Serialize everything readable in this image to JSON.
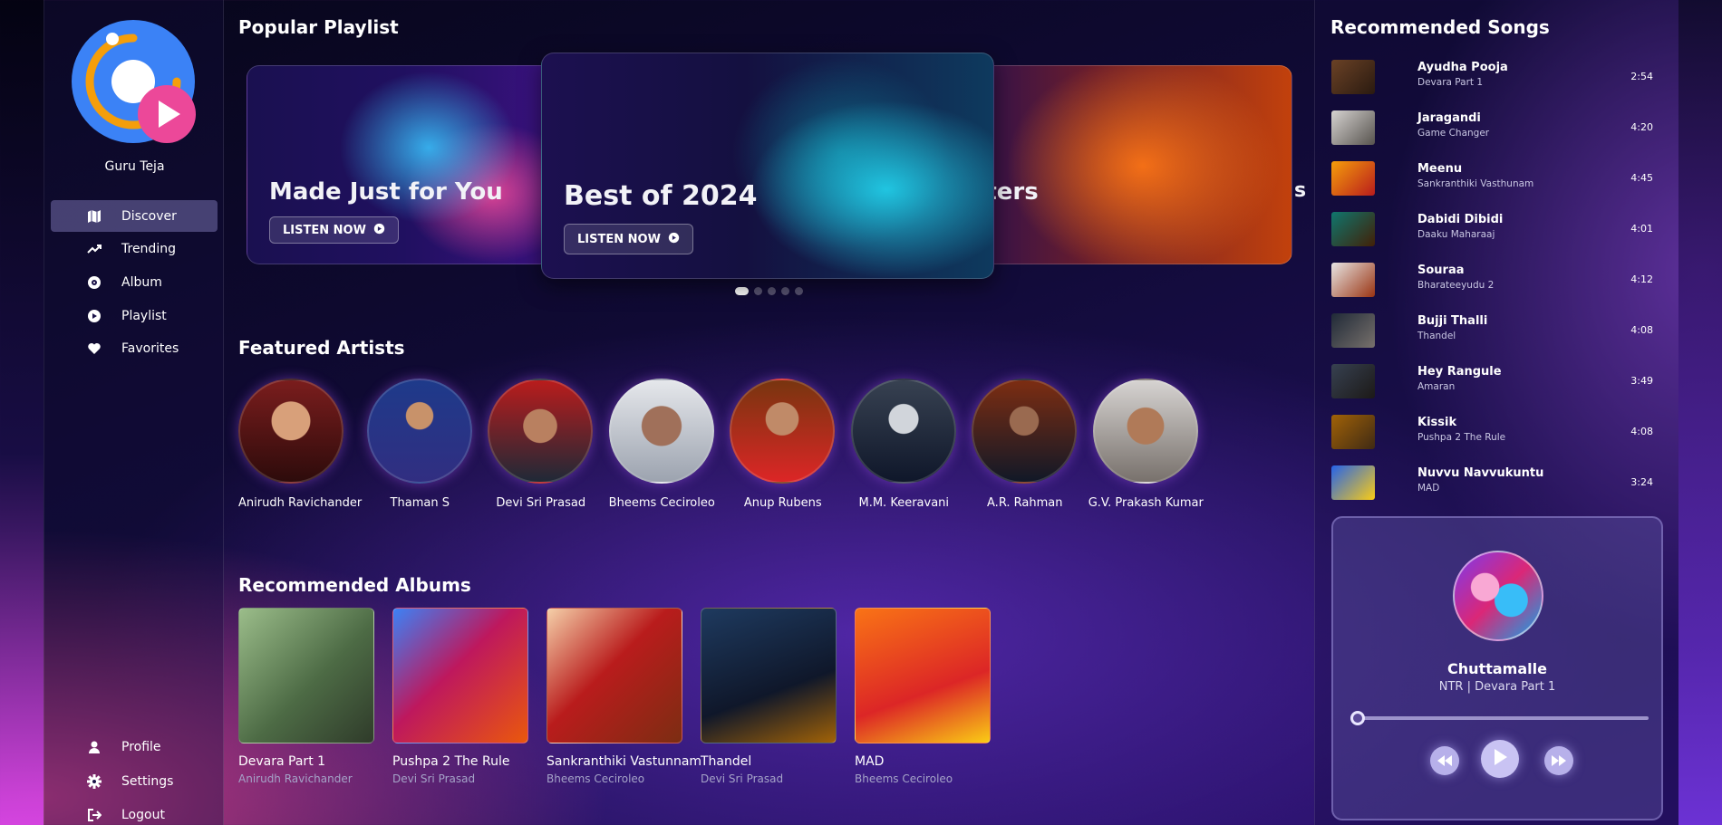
{
  "user": {
    "name": "Guru Teja"
  },
  "nav": {
    "items": [
      {
        "label": "Discover",
        "icon": "map-icon"
      },
      {
        "label": "Trending",
        "icon": "trending-icon"
      },
      {
        "label": "Album",
        "icon": "album-icon"
      },
      {
        "label": "Playlist",
        "icon": "play-circle-icon"
      },
      {
        "label": "Favorites",
        "icon": "heart-icon"
      }
    ],
    "bottom": [
      {
        "label": "Profile",
        "icon": "user-icon"
      },
      {
        "label": "Settings",
        "icon": "gear-icon"
      },
      {
        "label": "Logout",
        "icon": "logout-icon"
      }
    ]
  },
  "sections": {
    "playlist": "Popular Playlist",
    "artists": "Featured Artists",
    "albums": "Recommended Albums",
    "songs": "Recommended Songs"
  },
  "playlists": {
    "left_title": "Made Just for You",
    "center_title": "Best of 2024",
    "right_title": "arters",
    "right_edge": "s",
    "listen_label": "LISTEN NOW"
  },
  "artists": [
    "Anirudh Ravichander",
    "Thaman S",
    "Devi Sri Prasad",
    "Bheems Ceciroleo",
    "Anup Rubens",
    "M.M. Keeravani",
    "A.R. Rahman",
    "G.V. Prakash Kumar"
  ],
  "albums": [
    {
      "title": "Devara Part 1",
      "artist": "Anirudh Ravichander"
    },
    {
      "title": "Pushpa 2 The Rule",
      "artist": "Devi Sri Prasad"
    },
    {
      "title": "Sankranthiki Vastunnam",
      "artist": "Bheems Ceciroleo"
    },
    {
      "title": "Thandel",
      "artist": "Devi Sri Prasad"
    },
    {
      "title": "MAD",
      "artist": "Bheems Ceciroleo"
    }
  ],
  "songs": [
    {
      "title": "Ayudha Pooja",
      "album": "Devara Part 1",
      "duration": "2:54"
    },
    {
      "title": "Jaragandi",
      "album": "Game Changer",
      "duration": "4:20"
    },
    {
      "title": "Meenu",
      "album": "Sankranthiki Vasthunam",
      "duration": "4:45"
    },
    {
      "title": "Dabidi Dibidi",
      "album": "Daaku Maharaaj",
      "duration": "4:01"
    },
    {
      "title": "Souraa",
      "album": "Bharateeyudu 2",
      "duration": "4:12"
    },
    {
      "title": "Bujji Thalli",
      "album": "Thandel",
      "duration": "4:08"
    },
    {
      "title": "Hey Rangule",
      "album": "Amaran",
      "duration": "3:49"
    },
    {
      "title": "Kissik",
      "album": "Pushpa 2 The Rule",
      "duration": "4:08"
    },
    {
      "title": "Nuvvu Navvukuntu",
      "album": "MAD",
      "duration": "3:24"
    }
  ],
  "player": {
    "title": "Chuttamalle",
    "subtitle": "NTR | Devara Part 1",
    "progress": 0
  },
  "colors": {
    "accent": "#7c3aed",
    "logo_blue": "#3b82f6",
    "logo_orange": "#f59e0b",
    "logo_pink": "#ec4899"
  }
}
